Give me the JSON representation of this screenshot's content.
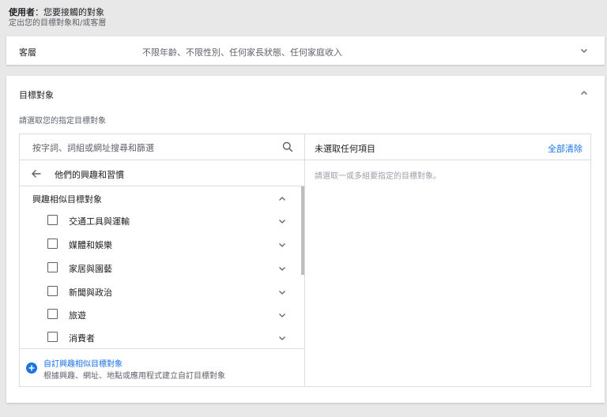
{
  "header": {
    "title_bold": "使用者",
    "title_rest": "：您要接觸的對象",
    "subtitle": "定出您的目標對象和/或客層"
  },
  "audience": {
    "label": "客層",
    "value": "不限年齡、不限性別、任何家長狀態、任何家庭收入"
  },
  "targeting": {
    "label": "目標對象",
    "hint": "請選取您的指定目標對象",
    "search": {
      "placeholder": "按字詞、詞組或網址搜尋和篩選"
    },
    "back_label": "他們的興趣和習慣",
    "group_title": "興趣相似目標對象",
    "items": [
      {
        "label": "交通工具與運輸"
      },
      {
        "label": "媒體和娛樂"
      },
      {
        "label": "家居與園藝"
      },
      {
        "label": "新聞與政治"
      },
      {
        "label": "旅遊"
      },
      {
        "label": "消費者"
      }
    ],
    "custom": {
      "title": "自訂興趣相似目標對象",
      "description": "根據興趣、網址、地點或應用程式建立自訂目標對象"
    },
    "selected": {
      "title": "未選取任何項目",
      "clear_all": "全部清除",
      "empty_text": "請選取一或多組要指定的目標對象。"
    }
  },
  "colors": {
    "accent": "#1a73e8",
    "border": "#dadce0",
    "background": "#e8e8e8"
  }
}
